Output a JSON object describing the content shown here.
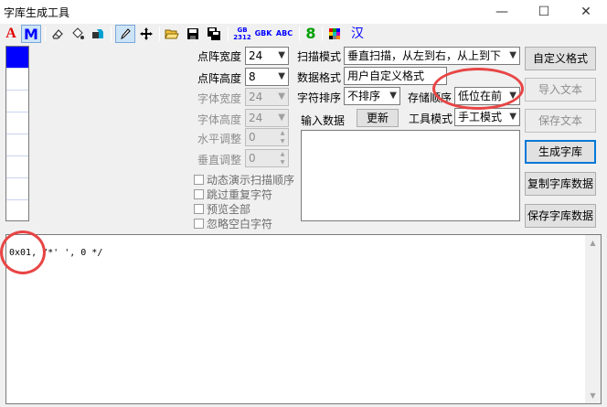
{
  "window": {
    "title": "字库生成工具",
    "minimize_glyph": "—",
    "maximize_glyph": "☐",
    "close_glyph": "✕"
  },
  "toolbar": {
    "font_a": "A",
    "font_m": "M",
    "gb2312_top": "GB",
    "gb2312_bottom": "2312",
    "gbk": "GBK",
    "abc": "ABC",
    "eight": "8",
    "han": "汉",
    "colors": {
      "red": "#e00000",
      "blue": "#0000ff",
      "green": "#00a000"
    }
  },
  "preview": {
    "rows": 8,
    "filled_rows": [
      0
    ],
    "fill_color": "#0000ff"
  },
  "settings": {
    "dot_width": {
      "label": "点阵宽度",
      "value": "24"
    },
    "dot_height": {
      "label": "点阵高度",
      "value": "8"
    },
    "font_width": {
      "label": "字体宽度",
      "value": "24"
    },
    "font_height": {
      "label": "字体高度",
      "value": "24"
    },
    "h_adjust": {
      "label": "水平调整",
      "value": "0"
    },
    "v_adjust": {
      "label": "垂直调整",
      "value": "0"
    }
  },
  "checkboxes": [
    "动态演示扫描顺序",
    "跳过重复字符",
    "预览全部",
    "忽略空白字符"
  ],
  "scan_mode": {
    "label": "扫描模式",
    "value": "垂直扫描，从左到右，从上到下"
  },
  "data_format": {
    "label": "数据格式",
    "value": "用户自定义格式"
  },
  "char_order": {
    "label": "字符排序",
    "value": "不排序"
  },
  "storage_order": {
    "label": "存储顺序",
    "value": "低位在前"
  },
  "input": {
    "label": "输入数据",
    "update_button": "更新"
  },
  "tool_mode": {
    "label": "工具模式",
    "value": "手工模式"
  },
  "buttons": {
    "custom_format": "自定义格式",
    "import_text": "导入文本",
    "save_text": "保存文本",
    "generate": "生成字库",
    "copy_data": "复制字库数据",
    "save_data": "保存字库数据"
  },
  "output": {
    "text": "0x01, /*' ', 0 */"
  },
  "annotations": {
    "color": "#e84545"
  }
}
